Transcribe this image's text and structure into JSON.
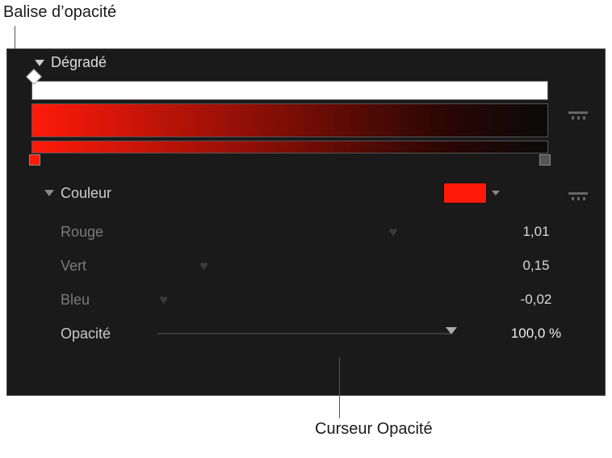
{
  "callouts": {
    "opacity_tag": "Balise d’opacité",
    "opacity_slider": "Curseur Opacité"
  },
  "section": {
    "title": "Dégradé"
  },
  "color_section": {
    "label": "Couleur",
    "swatch": "#ff1a0a",
    "channels": {
      "red": {
        "label": "Rouge",
        "value": "1,01"
      },
      "green": {
        "label": "Vert",
        "value": "0,15"
      },
      "blue": {
        "label": "Bleu",
        "value": "-0,02"
      }
    },
    "opacity": {
      "label": "Opacité",
      "value": "100,0 %"
    }
  },
  "gradient": {
    "opacity_tag_pos": 0,
    "stops": [
      {
        "pos": 0.0,
        "color": "#ff1a0a"
      },
      {
        "pos": 1.0,
        "color": "#333333"
      }
    ]
  }
}
